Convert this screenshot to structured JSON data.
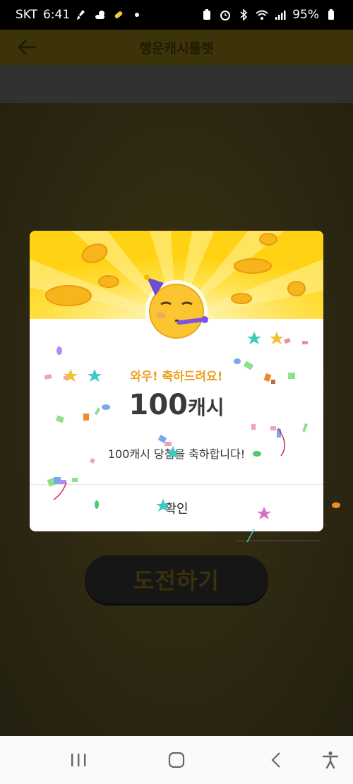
{
  "status_bar": {
    "carrier": "SKT",
    "time": "6:41",
    "battery": "95%",
    "icons_left": [
      "cleaning-icon",
      "weather-icon",
      "pill-icon",
      "dot-icon"
    ],
    "icons_right": [
      "battery-saver-icon",
      "alarm-icon",
      "bluetooth-icon",
      "wifi-icon",
      "signal-icon",
      "battery-icon"
    ]
  },
  "app_bar": {
    "title": "행운캐시룰렛",
    "back_icon": "arrow-left-icon"
  },
  "main": {
    "challenge_button_label": "도전하기"
  },
  "dialog": {
    "title": "와우! 축하드려요!",
    "amount_number": "100",
    "amount_unit": "캐시",
    "message": "100캐시 당첨을 축하합니다!",
    "confirm_label": "확인",
    "emoji": "🥳",
    "colors": {
      "banner": "#ffd51a",
      "title": "#f0a021"
    }
  },
  "nav_bar": {
    "icons": [
      "recent-apps-icon",
      "home-icon",
      "back-icon",
      "accessibility-icon"
    ]
  }
}
